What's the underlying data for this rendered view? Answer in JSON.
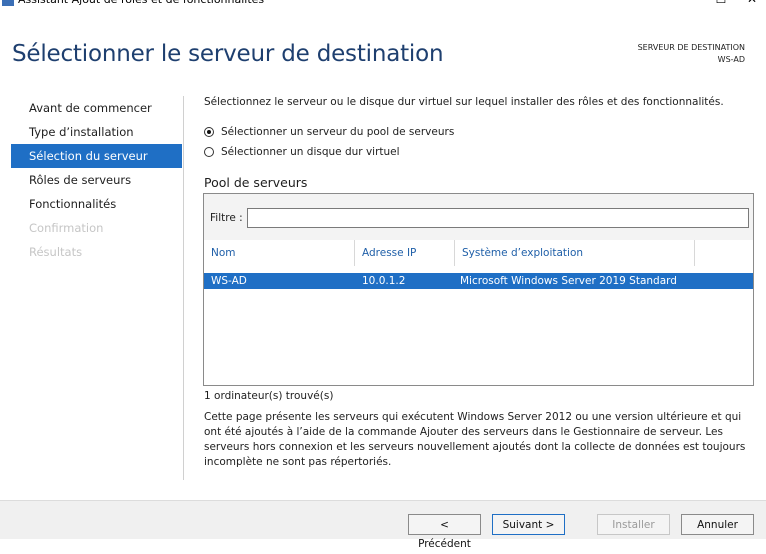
{
  "window": {
    "title": "Assistant Ajout de rôles et de fonctionnalités",
    "minimize_glyph": "—",
    "maximize_glyph": "☐",
    "close_glyph": "✕"
  },
  "header": {
    "title": "Sélectionner le serveur de destination",
    "dest_label": "SERVEUR DE DESTINATION",
    "dest_value": "WS-AD"
  },
  "sidebar": {
    "items": [
      {
        "label": "Avant de commencer",
        "state": "normal"
      },
      {
        "label": "Type d’installation",
        "state": "normal"
      },
      {
        "label": "Sélection du serveur",
        "state": "active"
      },
      {
        "label": "Rôles de serveurs",
        "state": "normal"
      },
      {
        "label": "Fonctionnalités",
        "state": "normal"
      },
      {
        "label": "Confirmation",
        "state": "disabled"
      },
      {
        "label": "Résultats",
        "state": "disabled"
      }
    ]
  },
  "main": {
    "intro": "Sélectionnez le serveur ou le disque dur virtuel sur lequel installer des rôles et des fonctionnalités.",
    "options": [
      {
        "label": "Sélectionner un serveur du pool de serveurs",
        "selected": true
      },
      {
        "label": "Sélectionner un disque dur virtuel",
        "selected": false
      }
    ],
    "pool_label": "Pool de serveurs",
    "filter_label": "Filtre :",
    "filter_value": "",
    "columns": [
      "Nom",
      "Adresse IP",
      "Système d’exploitation"
    ],
    "rows": [
      {
        "name": "WS-AD",
        "ip": "10.0.1.2",
        "os": "Microsoft Windows Server 2019 Standard",
        "selected": true
      }
    ],
    "found": "1 ordinateur(s) trouvé(s)",
    "description": "Cette page présente les serveurs qui exécutent Windows Server 2012 ou une version ultérieure et qui ont été ajoutés à l’aide de la commande Ajouter des serveurs dans le Gestionnaire de serveur. Les serveurs hors connexion et les serveurs nouvellement ajoutés dont la collecte de données est toujours incomplète ne sont pas répertoriés."
  },
  "footer": {
    "prev": "< Précédent",
    "next": "Suivant >",
    "install": "Installer",
    "cancel": "Annuler"
  },
  "colors": {
    "accent": "#1f6fc5",
    "title": "#1e3f6f",
    "disabled": "#c6c6c6"
  }
}
